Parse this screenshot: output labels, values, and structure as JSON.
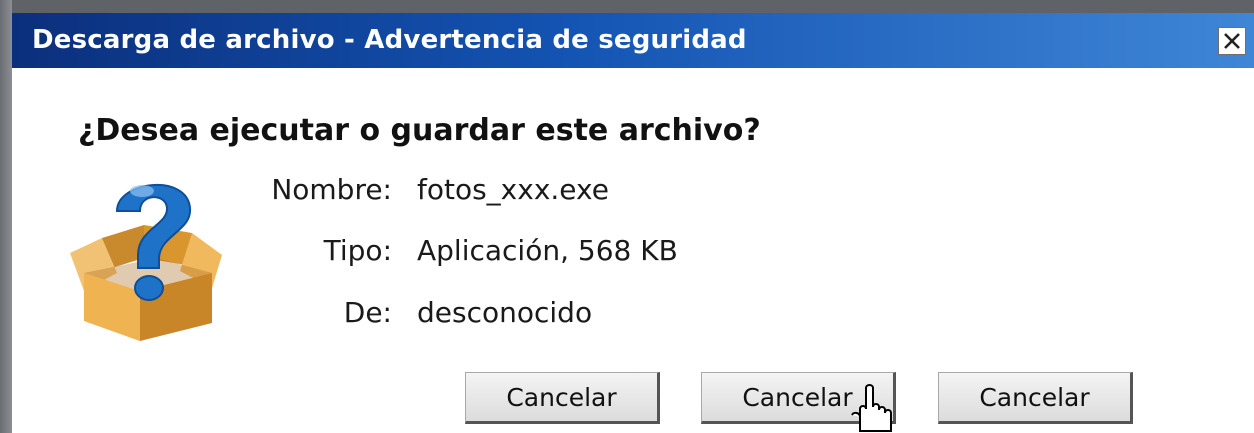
{
  "dialog": {
    "title": "Descarga de archivo - Advertencia de seguridad",
    "close_symbol": "✕",
    "question": "¿Desea ejecutar o guardar este archivo?",
    "icon": "question-box-icon",
    "fields": [
      {
        "label": "Nombre:",
        "value": "fotos_xxx.exe"
      },
      {
        "label": "Tipo:",
        "value": "Aplicación, 568 KB"
      },
      {
        "label": "De:",
        "value": "desconocido"
      }
    ],
    "buttons": [
      {
        "label": "Cancelar"
      },
      {
        "label": "Cancelar"
      },
      {
        "label": "Cancelar"
      }
    ]
  },
  "colors": {
    "titlebar_dark": "#0b2f7c",
    "titlebar_light": "#3f86d6",
    "box": "#e8a640",
    "question_mark": "#1e73c8"
  },
  "cursor": "hand-pointer-icon"
}
